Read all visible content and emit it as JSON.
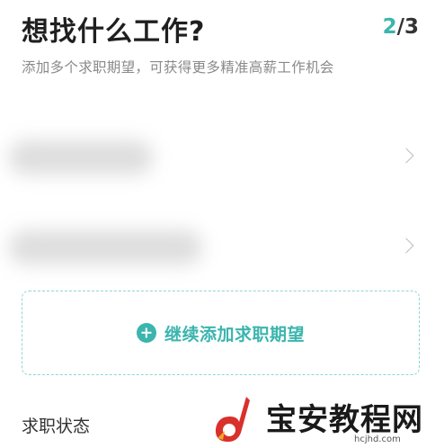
{
  "header": {
    "title": "想找什么工作?",
    "step_current": "2",
    "step_separator": "/",
    "step_total": "3",
    "subtitle": "添加多个求职期望，可获得更多精准高薪工作机会"
  },
  "expectations": [
    {
      "icon": "chevron-right-icon"
    },
    {
      "icon": "chevron-right-icon"
    }
  ],
  "add_button": {
    "label": "继续添加求职期望",
    "icon": "plus-circle-icon"
  },
  "section": {
    "label": "求职状态"
  },
  "watermark": {
    "text": "宝安教程网",
    "domain": "hcjhd.com"
  },
  "colors": {
    "accent": "#3bb5ae",
    "dashed_border": "#8fd6d0",
    "subtitle": "#8a8a8a",
    "watermark_red": "#d9302c"
  }
}
